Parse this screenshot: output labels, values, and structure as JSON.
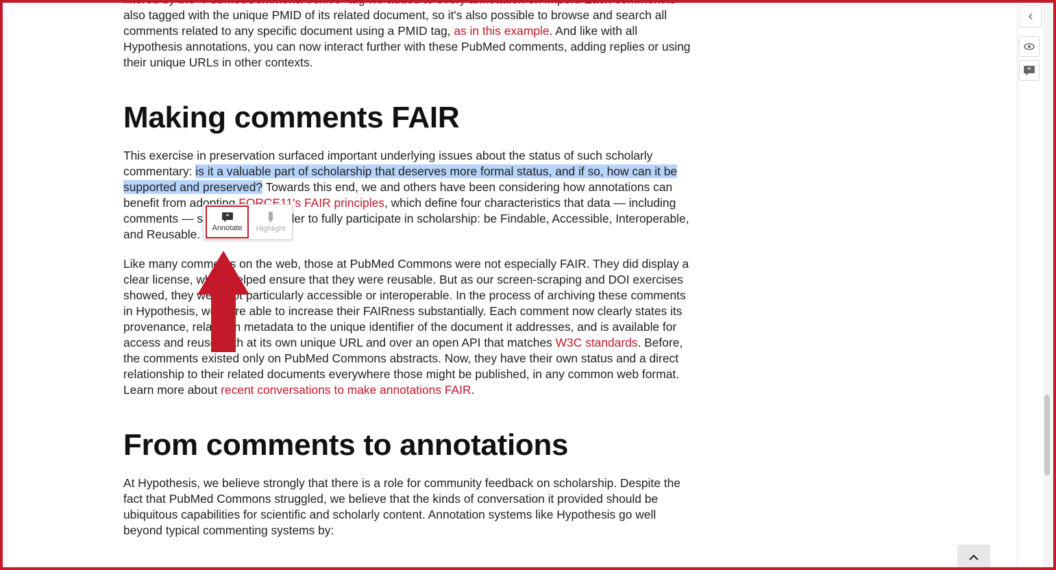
{
  "article": {
    "para1_text": "filtered by the \"PubMedCommonsArchive\" tag we added to every annotation on import. Each comment is also tagged with the unique PMID of its related document, so it's also possible to browse and search all comments related to any specific document using a PMID tag, ",
    "para1_link": "as in this example",
    "para1_tail": ". And like with all Hypothesis annotations, you can now interact further with these PubMed comments, adding replies or using their unique URLs in other contexts.",
    "heading1": "Making comments FAIR",
    "para2_a": "This exercise in preservation surfaced important underlying issues about the status of such scholarly commentary: ",
    "para2_highlight": "is it a valuable part of scholarship that deserves more formal status, and if so, how can it be supported and preserved?",
    "para2_b": " Towards this end, we and others have been considering how annotations can benefit from adopting ",
    "para2_link": "FORCE11's FAIR principles",
    "para2_c": ", which define four characteristics that data — including comments — should have in order to fully participate in scholarship: be Findable, Accessible, Interoperable, and Reusable.",
    "para3_a": "Like many comments on the web, those at PubMed Commons were not especially FAIR. They did display a clear license, which helped ensure that they were reusable. But as our screen-scraping and DOI exercises showed, they were not particularly accessible or interoperable. In the process of archiving these comments in Hypothesis, we were able to increase their FAIRness substantially. Each comment now clearly states its provenance, relates in metadata to the unique identifier of the document it addresses, and is available for access and reuse both at its own unique URL and over an open API that matches ",
    "para3_link1": "W3C standards",
    "para3_b": ". Before, the comments existed only on PubMed Commons abstracts. Now, they have their own status and a direct relationship to their related documents everywhere those might be published, in any common web format. Learn more about ",
    "para3_link2": "recent conversations to make annotations FAIR",
    "para3_c": ".",
    "heading2": "From comments to annotations",
    "para4": "At Hypothesis, we believe strongly that there is a role for community feedback on scholarship. Despite the fact that PubMed Commons struggled, we believe that the kinds of conversation it provided should be ubiquitous capabilities for scientific and scholarly content. Annotation systems like Hypothesis go well beyond typical commenting systems by:"
  },
  "adder": {
    "annotate_label": "Annotate",
    "highlight_label": "Highlight"
  },
  "sidebar": {
    "collapse_icon": "chevron-left-icon",
    "visibility_icon": "eye-icon",
    "annotate_page_icon": "page-note-icon"
  },
  "colors": {
    "accent": "#c4182b",
    "selection": "#b6d4fc"
  }
}
